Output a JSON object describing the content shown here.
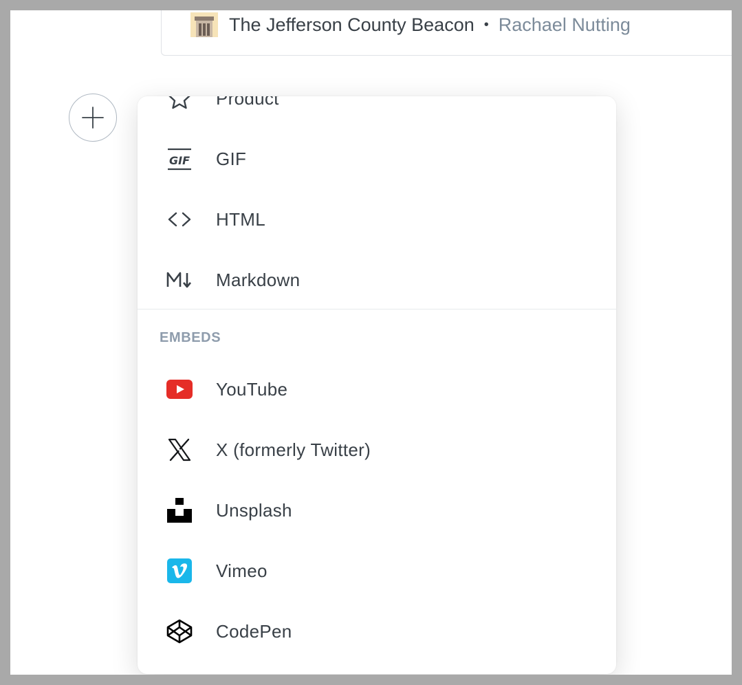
{
  "bookmark": {
    "publisher": "The Jefferson County Beacon",
    "separator": "•",
    "author": "Rachael Nutting"
  },
  "plus_button": {
    "icon": "plus-icon"
  },
  "menu": {
    "items": [
      {
        "label": "Product",
        "icon": "star-icon"
      },
      {
        "label": "GIF",
        "icon": "gif-icon"
      },
      {
        "label": "HTML",
        "icon": "code-icon"
      },
      {
        "label": "Markdown",
        "icon": "markdown-icon"
      }
    ],
    "embeds_header": "EMBEDS",
    "embeds": [
      {
        "label": "YouTube",
        "icon": "youtube-icon",
        "color": "#e52d27"
      },
      {
        "label": "X (formerly Twitter)",
        "icon": "x-icon",
        "color": "#15171a"
      },
      {
        "label": "Unsplash",
        "icon": "unsplash-icon",
        "color": "#000000"
      },
      {
        "label": "Vimeo",
        "icon": "vimeo-icon",
        "color": "#1ab7ea"
      },
      {
        "label": "CodePen",
        "icon": "codepen-icon",
        "color": "#000000"
      }
    ]
  }
}
